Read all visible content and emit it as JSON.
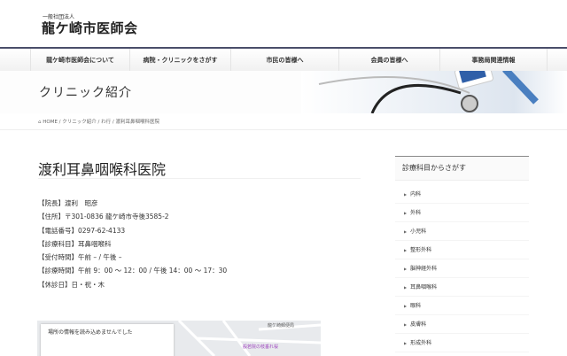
{
  "header": {
    "logo_small": "一般社団法人",
    "logo_big": "龍ケ崎市医師会"
  },
  "nav": [
    {
      "label": "龍ケ崎市医師会について"
    },
    {
      "label": "病院・クリニックをさがす"
    },
    {
      "label": "市民の皆様へ"
    },
    {
      "label": "会員の皆様へ"
    },
    {
      "label": "事務局関連情報"
    }
  ],
  "banner": {
    "title": "クリニック紹介"
  },
  "breadcrumb": {
    "home": "HOME",
    "items": [
      "クリニック紹介",
      "わ行",
      "渡利耳鼻咽喉科医院"
    ]
  },
  "main": {
    "title": "渡利耳鼻咽喉科医院",
    "info": [
      "【院長】渡利　昭彦",
      "【住所】〒301-0836 龍ケ崎市寺後3585-2",
      "【電話番号】0297-62-4133",
      "【診療科目】耳鼻咽喉科",
      "【受付時間】午前 – / 午後 –",
      "【診療時間】午前 9：00 ～ 12：00 / 午後 14：00 ～ 17：30",
      "【休診日】日・祝・木"
    ]
  },
  "map": {
    "error": "場所の情報を読み込めませんでした",
    "label1": "龍ケ崎郵便局",
    "label2": "般若院の枝垂れ桜"
  },
  "sidebar": {
    "title": "診療科目からさがす",
    "items": [
      "内科",
      "外科",
      "小児科",
      "整形外科",
      "脳神経外科",
      "耳鼻咽喉科",
      "眼科",
      "皮膚科",
      "形成外科"
    ]
  }
}
